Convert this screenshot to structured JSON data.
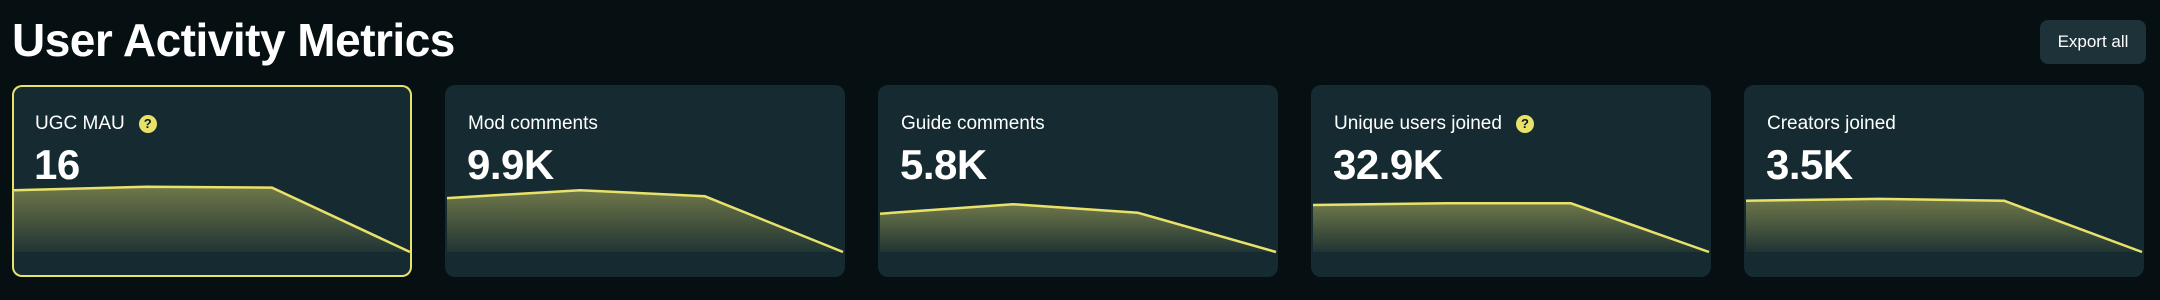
{
  "header": {
    "title": "User Activity Metrics",
    "export_label": "Export all"
  },
  "colors": {
    "background": "#060f12",
    "card": "#162b31",
    "accent": "#e9e26a",
    "button": "#1d3339"
  },
  "cards": [
    {
      "label": "UGC MAU",
      "value": "16",
      "help_icon": "question-circle-icon",
      "selected": true,
      "trend": [
        0.71,
        0.75,
        0.74,
        0.0
      ]
    },
    {
      "label": "Mod comments",
      "value": "9.9K",
      "help_icon": null,
      "selected": false,
      "trend": [
        0.62,
        0.71,
        0.64,
        0.0
      ]
    },
    {
      "label": "Guide comments",
      "value": "5.8K",
      "help_icon": null,
      "selected": false,
      "trend": [
        0.44,
        0.55,
        0.45,
        0.0
      ]
    },
    {
      "label": "Unique users joined",
      "value": "32.9K",
      "help_icon": "question-circle-icon",
      "selected": false,
      "trend": [
        0.54,
        0.56,
        0.56,
        0.0
      ]
    },
    {
      "label": "Creators joined",
      "value": "3.5K",
      "help_icon": null,
      "selected": false,
      "trend": [
        0.59,
        0.61,
        0.59,
        0.0
      ]
    }
  ]
}
